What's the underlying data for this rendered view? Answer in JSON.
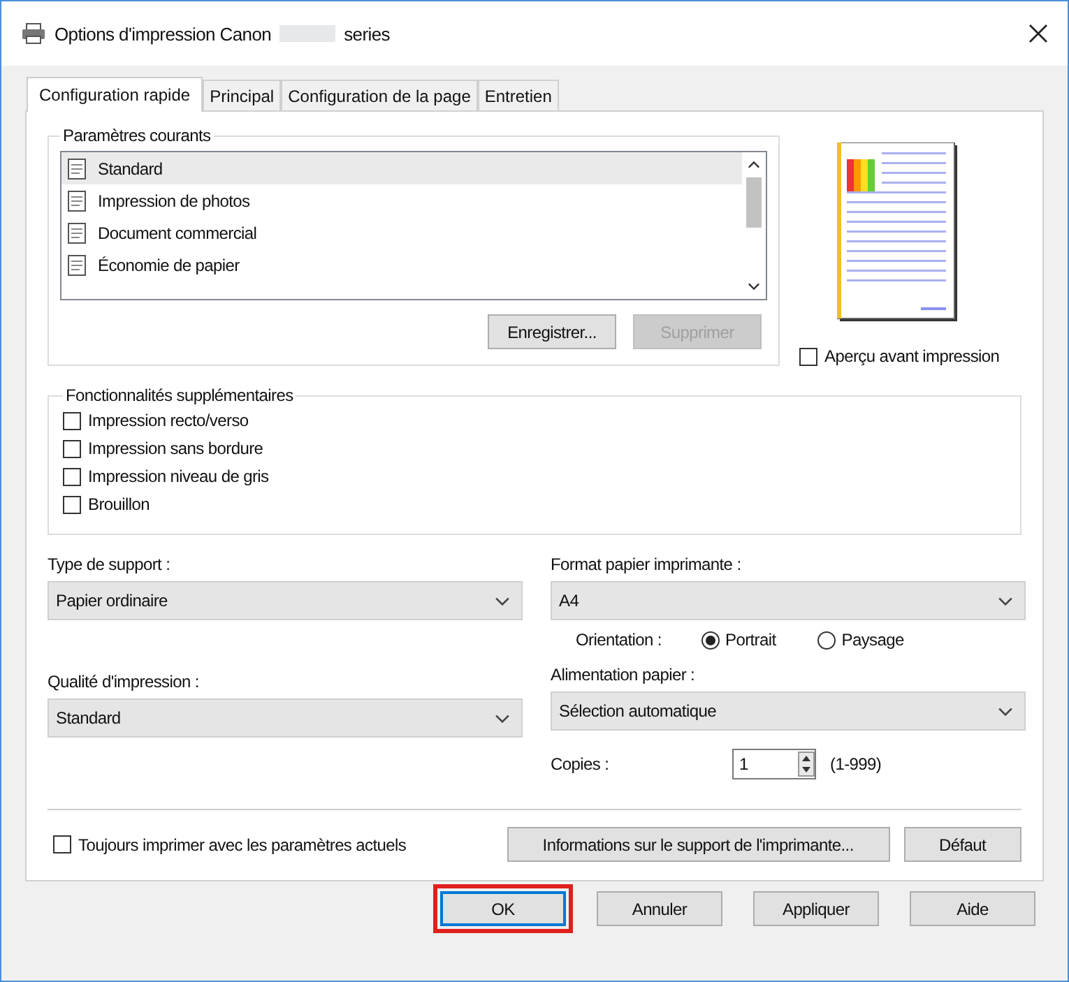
{
  "window": {
    "title": "Options d'impression Canon",
    "title_suffix": "series"
  },
  "tabs": [
    {
      "label": "Configuration rapide",
      "selected": true
    },
    {
      "label": "Principal",
      "selected": false
    },
    {
      "label": "Configuration de la page",
      "selected": false
    },
    {
      "label": "Entretien",
      "selected": false
    }
  ],
  "presets": {
    "label": "Paramètres courants",
    "items": [
      {
        "label": "Standard",
        "selected": true
      },
      {
        "label": "Impression de photos",
        "selected": false
      },
      {
        "label": "Document commercial",
        "selected": false
      },
      {
        "label": "Économie de papier",
        "selected": false
      }
    ],
    "buttons": [
      {
        "label": "Enregistrer...",
        "disabled": false
      },
      {
        "label": "Supprimer",
        "disabled": true
      }
    ]
  },
  "preview": {
    "label": "Aperçu avant impression",
    "checked": false
  },
  "features": {
    "label": "Fonctionnalités supplémentaires",
    "items": [
      {
        "label": "Impression recto/verso",
        "checked": false
      },
      {
        "label": "Impression sans bordure",
        "checked": false
      },
      {
        "label": "Impression niveau de gris",
        "checked": false
      },
      {
        "label": "Brouillon",
        "checked": false
      }
    ]
  },
  "media_type": {
    "label": "Type de support :",
    "value": "Papier ordinaire"
  },
  "paper_size": {
    "label": "Format papier imprimante :",
    "value": "A4"
  },
  "orientation": {
    "label": "Orientation :",
    "options": [
      {
        "label": "Portrait",
        "selected": true
      },
      {
        "label": "Paysage",
        "selected": false
      }
    ]
  },
  "print_quality": {
    "label": "Qualité d'impression :",
    "value": "Standard"
  },
  "paper_source": {
    "label": "Alimentation papier :",
    "value": "Sélection automatique"
  },
  "copies": {
    "label": "Copies :",
    "value": "1",
    "range": "(1-999)"
  },
  "always_print": {
    "label": "Toujours imprimer avec les paramètres actuels",
    "checked": false
  },
  "info_button": "Informations sur le support de l'imprimante...",
  "default_button": "Défaut",
  "buttons": [
    {
      "label": "OK",
      "highlighted": true
    },
    {
      "label": "Annuler",
      "highlighted": false
    },
    {
      "label": "Appliquer",
      "highlighted": false
    },
    {
      "label": "Aide",
      "highlighted": false
    }
  ]
}
